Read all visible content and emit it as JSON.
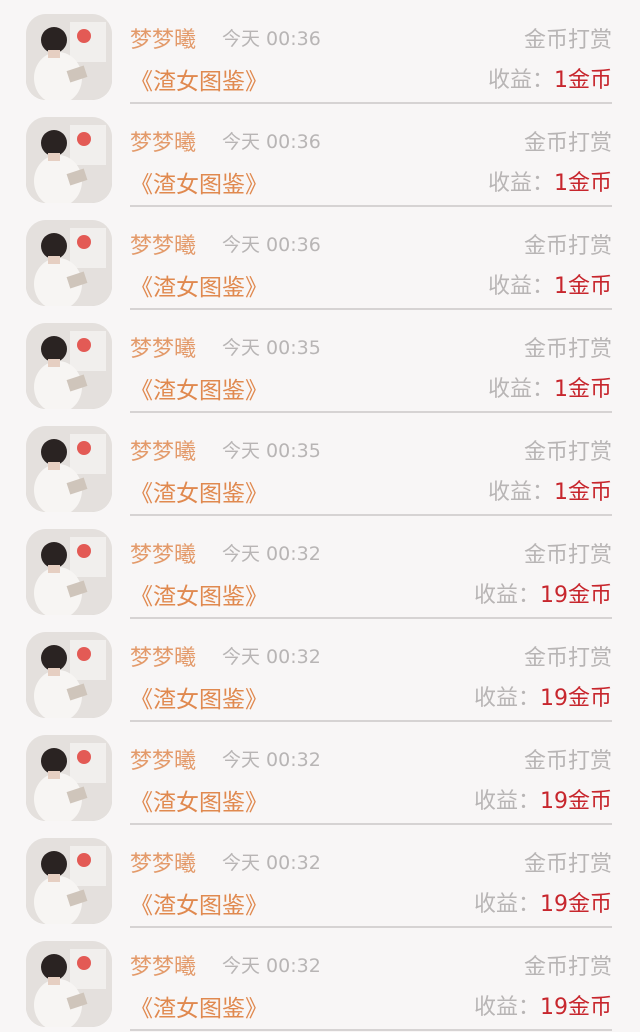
{
  "records": [
    {
      "name": "梦梦曦",
      "time": "今天 00:36",
      "type": "金币打赏",
      "book": "《渣女图鉴》",
      "income_label": "收益：",
      "income_amount": "1金币"
    },
    {
      "name": "梦梦曦",
      "time": "今天 00:36",
      "type": "金币打赏",
      "book": "《渣女图鉴》",
      "income_label": "收益：",
      "income_amount": "1金币"
    },
    {
      "name": "梦梦曦",
      "time": "今天 00:36",
      "type": "金币打赏",
      "book": "《渣女图鉴》",
      "income_label": "收益：",
      "income_amount": "1金币"
    },
    {
      "name": "梦梦曦",
      "time": "今天 00:35",
      "type": "金币打赏",
      "book": "《渣女图鉴》",
      "income_label": "收益：",
      "income_amount": "1金币"
    },
    {
      "name": "梦梦曦",
      "time": "今天 00:35",
      "type": "金币打赏",
      "book": "《渣女图鉴》",
      "income_label": "收益：",
      "income_amount": "1金币"
    },
    {
      "name": "梦梦曦",
      "time": "今天 00:32",
      "type": "金币打赏",
      "book": "《渣女图鉴》",
      "income_label": "收益：",
      "income_amount": "19金币"
    },
    {
      "name": "梦梦曦",
      "time": "今天 00:32",
      "type": "金币打赏",
      "book": "《渣女图鉴》",
      "income_label": "收益：",
      "income_amount": "19金币"
    },
    {
      "name": "梦梦曦",
      "time": "今天 00:32",
      "type": "金币打赏",
      "book": "《渣女图鉴》",
      "income_label": "收益：",
      "income_amount": "19金币"
    },
    {
      "name": "梦梦曦",
      "time": "今天 00:32",
      "type": "金币打赏",
      "book": "《渣女图鉴》",
      "income_label": "收益：",
      "income_amount": "19金币"
    },
    {
      "name": "梦梦曦",
      "time": "今天 00:32",
      "type": "金币打赏",
      "book": "《渣女图鉴》",
      "income_label": "收益：",
      "income_amount": "19金币"
    }
  ],
  "colors": {
    "name": "#e39a6a",
    "book": "#e0894f",
    "muted": "#b8b5b5",
    "amount": "#c7262d",
    "divider": "#d6d3d3",
    "background": "#f8f6f6"
  }
}
